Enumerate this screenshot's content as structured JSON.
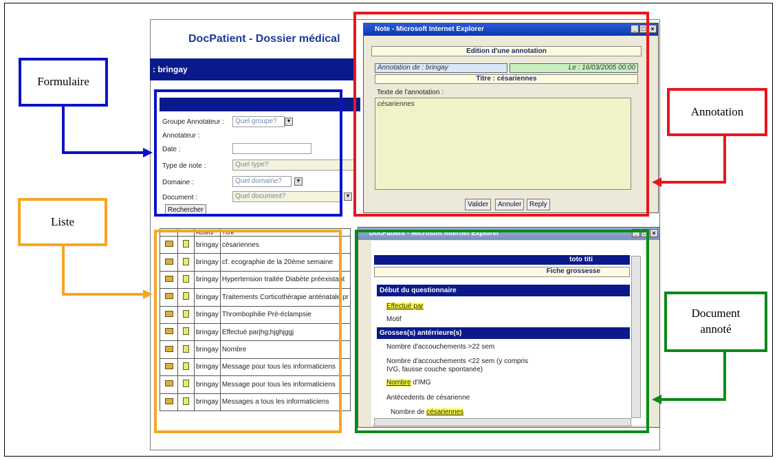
{
  "app": {
    "title": "DocPatient - Dossier médical",
    "user": ": bringay"
  },
  "form": {
    "groupe_label": "Groupe Annotateur :",
    "groupe_value": "Quel groupe?",
    "annotateur_label": "Annotateur :",
    "date_label": "Date :",
    "type_label": "Type de note :",
    "type_value": "Quel type?",
    "domaine_label": "Domaine :",
    "domaine_value": "Quel domaine?",
    "document_label": "Document :",
    "document_value": "Quel document?",
    "search_label": "Rechercher"
  },
  "list": {
    "col_author": "Auteur",
    "col_title": "Titre",
    "rows": [
      {
        "author": "bringay",
        "title": "césariennes"
      },
      {
        "author": "bringay",
        "title": "cf. ecographie de la 20ème semaine"
      },
      {
        "author": "bringay",
        "title": "Hypertension traitée Diabète préexistant"
      },
      {
        "author": "bringay",
        "title": "Traitements Corticothérapie anténatale pr"
      },
      {
        "author": "bringay",
        "title": "Thrombophilie Pré-éclampsie"
      },
      {
        "author": "bringay",
        "title": "Effectué parjhg;hjghjggj"
      },
      {
        "author": "bringay",
        "title": "Nombre"
      },
      {
        "author": "bringay",
        "title": "Message pour tous les informaticiens"
      },
      {
        "author": "bringay",
        "title": "Message pour tous les informaticiens"
      },
      {
        "author": "bringay",
        "title": "Messages a tous les informaticiens"
      }
    ]
  },
  "note_window": {
    "title": "Note - Microsoft Internet Explorer",
    "heading": "Edition d'une annotation",
    "author": "Annotation de : bringay",
    "date": "Le : 16/03/2005 00:00",
    "titre": "Titre : césariennes",
    "text_label": "Texte de l'annotation :",
    "text_value": "césariennes",
    "btn_valider": "Valider",
    "btn_annuler": "Annuler",
    "btn_reply": "Reply"
  },
  "doc_window": {
    "title": "DocPatient - Microsoft Internet Explorer",
    "patient": "toto titi",
    "form_name": "Fiche grossesse",
    "section1": "Début du questionnaire",
    "item1": "Effectué par",
    "item2": "Motif",
    "section2": "Grosses(s) antérrieure(s)",
    "item3": "Nombre d'accouchements >22 sem",
    "item4a": "Nombre d'accouchements <22 sem (y compris",
    "item4b": "IVG, fausse couche spontanée)",
    "item5_hl": "Nombre",
    "item5_rest": " d'IMG",
    "item6": "Antécedents de césarienne",
    "item7_pre": "Nombre de ",
    "item7_hl": "césariennes"
  },
  "callouts": {
    "formulaire": "Formulaire",
    "liste": "Liste",
    "annotation": "Annotation",
    "document_l1": "Document",
    "document_l2": "annoté"
  },
  "colors": {
    "formulaire": "#0a12c8",
    "liste": "#f5a623",
    "annotation": "#e8161c",
    "document": "#0a8a1a"
  }
}
